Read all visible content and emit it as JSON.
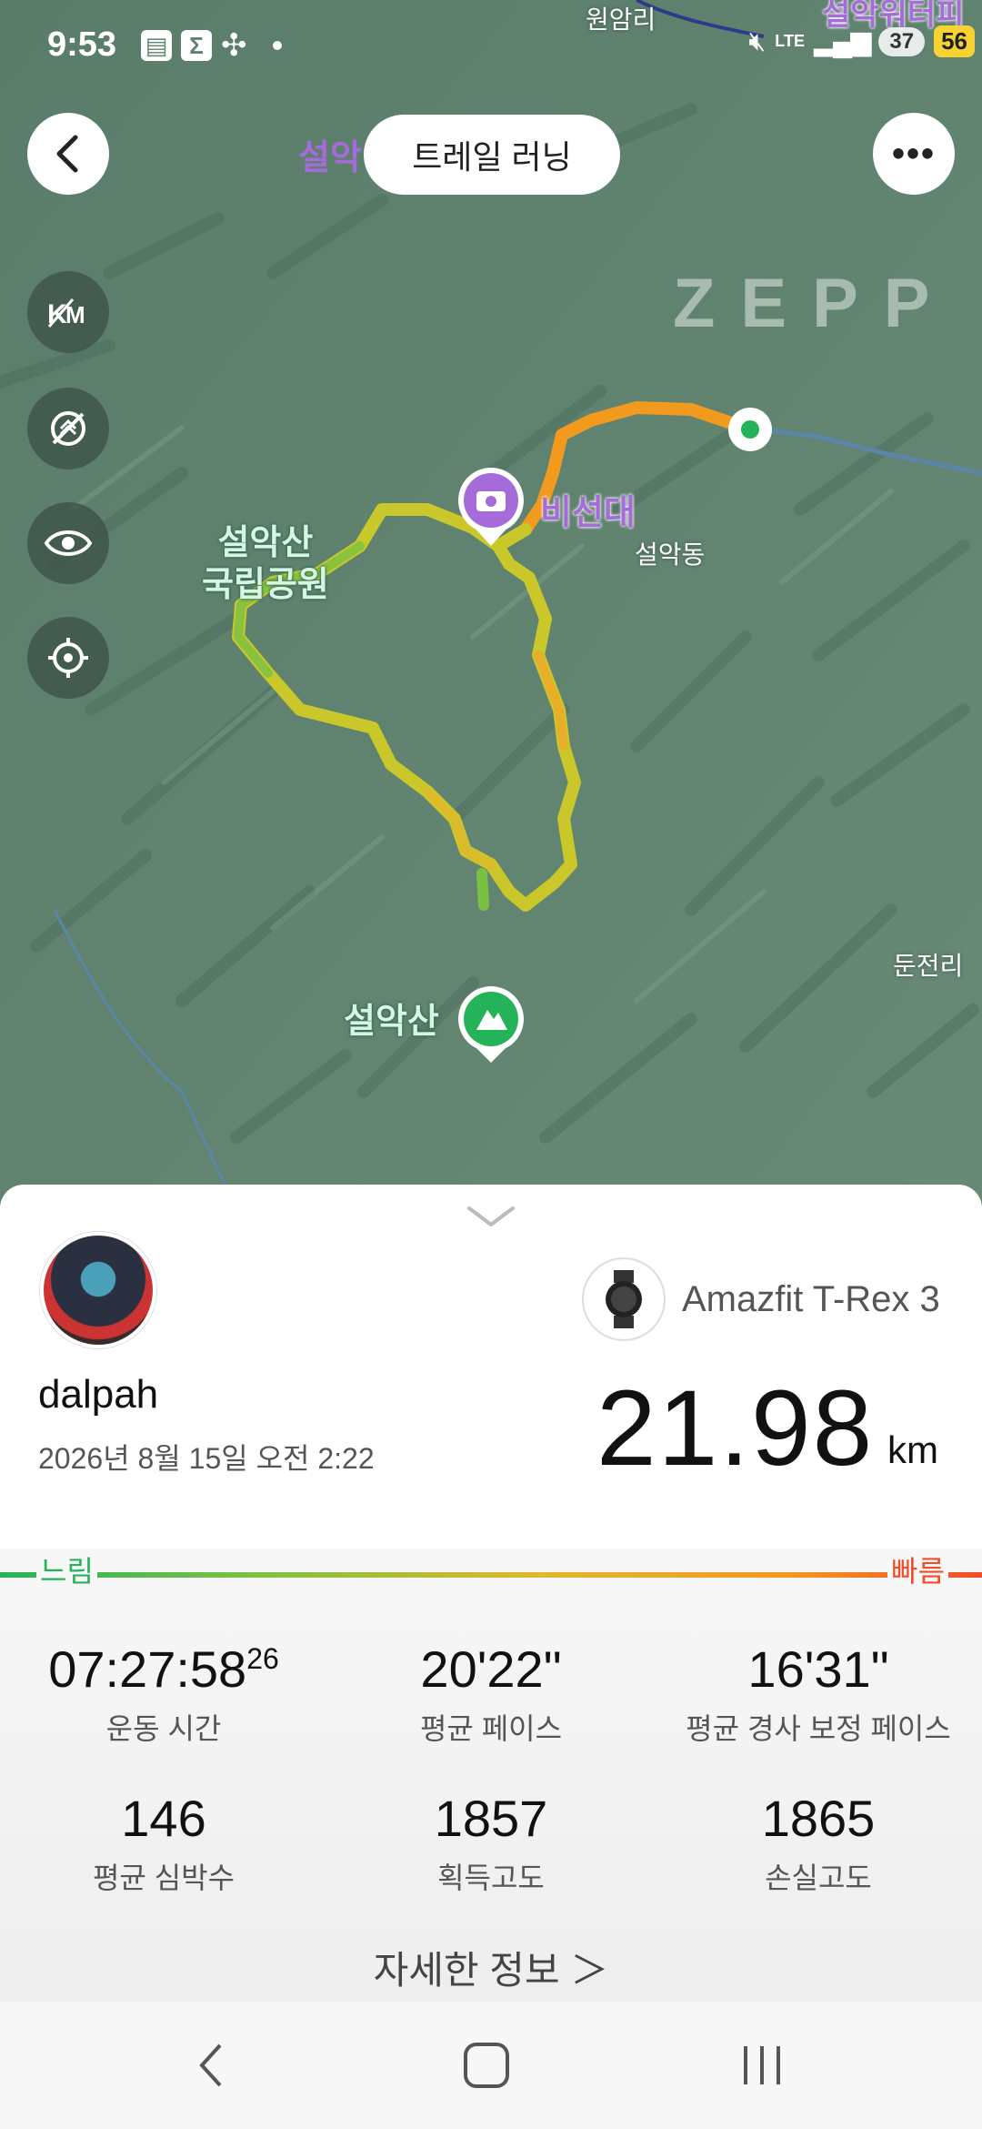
{
  "status_bar": {
    "time": "9:53",
    "network": "LTE",
    "battery": "37",
    "badge": "56"
  },
  "top_bar": {
    "title": "트레일 러닝",
    "map_label_fragment": "설악"
  },
  "map": {
    "watermark": "ZEPP",
    "labels": {
      "park": "설악산\n국립공원",
      "bisundae": "비선대",
      "seorakdong": "설악동",
      "seoraksan": "설악산",
      "dunjeonri": "둔전리",
      "wonamri": "원암리",
      "top_right": "설악워터피"
    },
    "route_colors": {
      "slow": "#25b35a",
      "mid": "#c9c72a",
      "fast": "#f29a1e"
    }
  },
  "summary": {
    "username": "dalpah",
    "datetime": "2026년 8월 15일 오전 2:22",
    "device": "Amazfit T-Rex 3",
    "distance": "21.98",
    "distance_unit": "km",
    "pace_scale": {
      "slow_label": "느림",
      "fast_label": "빠름"
    }
  },
  "stats": [
    {
      "value": "07:27:58",
      "sub": "26",
      "label": "운동 시간"
    },
    {
      "value": "20'22\"",
      "label": "평균 페이스"
    },
    {
      "value": "16'31\"",
      "label": "평균 경사 보정 페이스"
    },
    {
      "value": "146",
      "label": "평균 심박수"
    },
    {
      "value": "1857",
      "label": "획득고도"
    },
    {
      "value": "1865",
      "label": "손실고도"
    }
  ],
  "detail_link": "자세한 정보 ＞"
}
